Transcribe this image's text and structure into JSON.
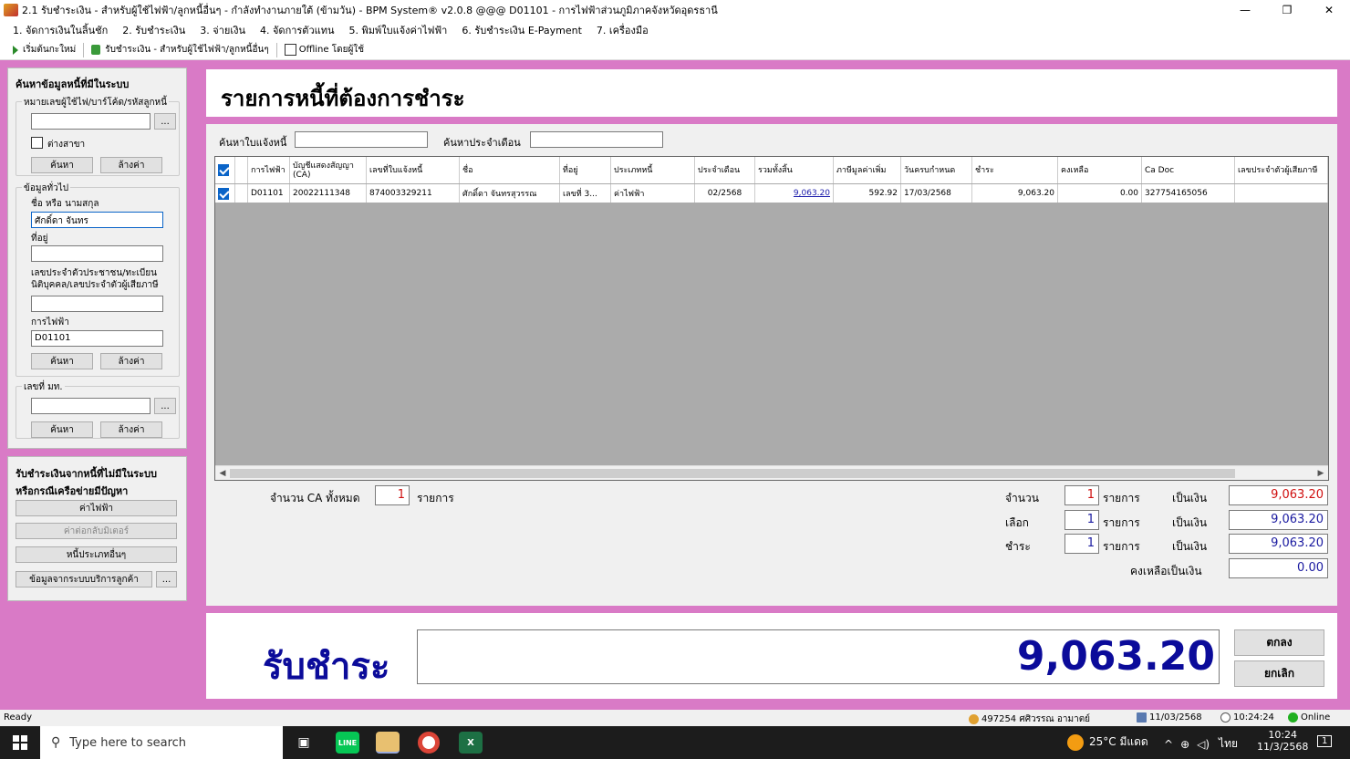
{
  "window": {
    "title": "2.1  รับชำระเงิน - สำหรับผู้ใช้ไฟฟ้า/ลูกหนี้อื่นๆ - กำลังทำงานภายใต้ (ข้ามวัน) - BPM System® v2.0.8 @@@ D01101 - การไฟฟ้าส่วนภูมิภาคจังหวัดอุดรธานี",
    "minimize": "—",
    "restore": "❐",
    "close": "✕"
  },
  "menu": [
    "1. จัดการเงินในลิ้นชัก",
    "2. รับชำระเงิน",
    "3. จ่ายเงิน",
    "4. จัดการตัวแทน",
    "5. พิมพ์ใบแจ้งค่าไฟฟ้า",
    "6. รับชำระเงิน E-Payment",
    "7. เครื่องมือ"
  ],
  "toolbar": {
    "start_new": "เริ่มต้นกะใหม่",
    "receive_payment": "รับชำระเงิน - สำหรับผู้ใช้ไฟฟ้า/ลูกหนี้อื่นๆ",
    "offline": "Offline โดยผู้ใช้"
  },
  "left": {
    "title": "ค้นหาข้อมูลหนี้ที่มีในระบบ",
    "group1_label": "หมายเลขผู้ใช้ไฟ/บาร์โค้ด/รหัสลูกหนี้",
    "group1_value": "",
    "ellipsis": "...",
    "diff_branch": "ต่างสาขา",
    "search": "ค้นหา",
    "clear": "ล้างค่า",
    "group2_label": "ข้อมูลทั่วไป",
    "name_label": "ชื่อ หรือ นามสกุล",
    "name_value": "ศักดิ์ดา จันทร",
    "address_label": "ที่อยู่",
    "address_value": "",
    "id_label_1": "เลขประจำตัวประชาชน/ทะเบียน",
    "id_label_2": "นิติบุคคล/เลขประจำตัวผู้เสียภาษี",
    "id_value": "",
    "pea_label": "การไฟฟ้า",
    "pea_value": "D01101",
    "group3_label": "เลขที่ มท.",
    "group3_value": "",
    "panel2_title_1": "รับชำระเงินจากหนี้ที่ไม่มีในระบบ",
    "panel2_title_2": "หรือกรณีเครือข่ายมีปัญหา",
    "btn_electricity": "ค่าไฟฟ้า",
    "btn_reconnect": "ค่าต่อกลับมิเตอร์",
    "btn_other": "หนี้ประเภทอื่นๆ",
    "btn_customer_service": "ข้อมูลจากระบบบริการลูกค้า"
  },
  "header": {
    "title": "รายการหนี้ที่ต้องการชำระ"
  },
  "filters": {
    "bill_label": "ค้นหาใบแจ้งหนี้",
    "bill_value": "",
    "month_label": "ค้นหาประจำเดือน",
    "month_value": ""
  },
  "grid": {
    "columns": [
      "การไฟฟ้า",
      "บัญชีแสดงสัญญา (CA)",
      "เลขที่ใบแจ้งหนี้",
      "ชื่อ",
      "ที่อยู่",
      "ประเภทหนี้",
      "ประจำเดือน",
      "รวมทั้งสิ้น",
      "ภาษีมูลค่าเพิ่ม",
      "วันครบกำหนด",
      "ชำระ",
      "คงเหลือ",
      "Ca Doc",
      "เลขประจำตัวผู้เสียภาษี"
    ],
    "rows": [
      {
        "checked": true,
        "cells": [
          "D01101",
          "20022111348",
          "874003329211",
          "ศักดิ์ดา จันทรสุวรรณ",
          "เลขที่ 3...",
          "ค่าไฟฟ้า",
          "02/2568",
          "9,063.20",
          "592.92",
          "17/03/2568",
          "9,063.20",
          "0.00",
          "327754165056",
          ""
        ]
      }
    ]
  },
  "summary": {
    "ca_total_label": "จำนวน CA ทั้งหมด",
    "ca_total": "1",
    "items": "รายการ",
    "count_label": "จำนวน",
    "select_label": "เลือก",
    "pay_label": "ชำระ",
    "as_money": "เป็นเงิน",
    "count": "1",
    "count_amount": "9,063.20",
    "select": "1",
    "select_amount": "9,063.20",
    "pay": "1",
    "pay_amount": "9,063.20",
    "remaining_label": "คงเหลือเป็นเงิน",
    "remaining": "0.00"
  },
  "payment": {
    "label": "รับชำระ",
    "amount": "9,063.20",
    "ok": "ตกลง",
    "cancel": "ยกเลิก"
  },
  "status": {
    "ready": "Ready",
    "user": "497254 ศศิวรรณ อามาตย์",
    "date": "11/03/2568",
    "time": "10:24:24",
    "online": "Online"
  },
  "taskbar": {
    "search_placeholder": "Type here to search",
    "weather": "25°C มีแดด",
    "lang": "ไทย",
    "clock_time": "10:24",
    "clock_date": "11/3/2568",
    "notif": "1"
  },
  "colors": {
    "accent_pink": "#d97ac6",
    "amount_blue": "#0b0b9a",
    "red": "#d01010"
  }
}
